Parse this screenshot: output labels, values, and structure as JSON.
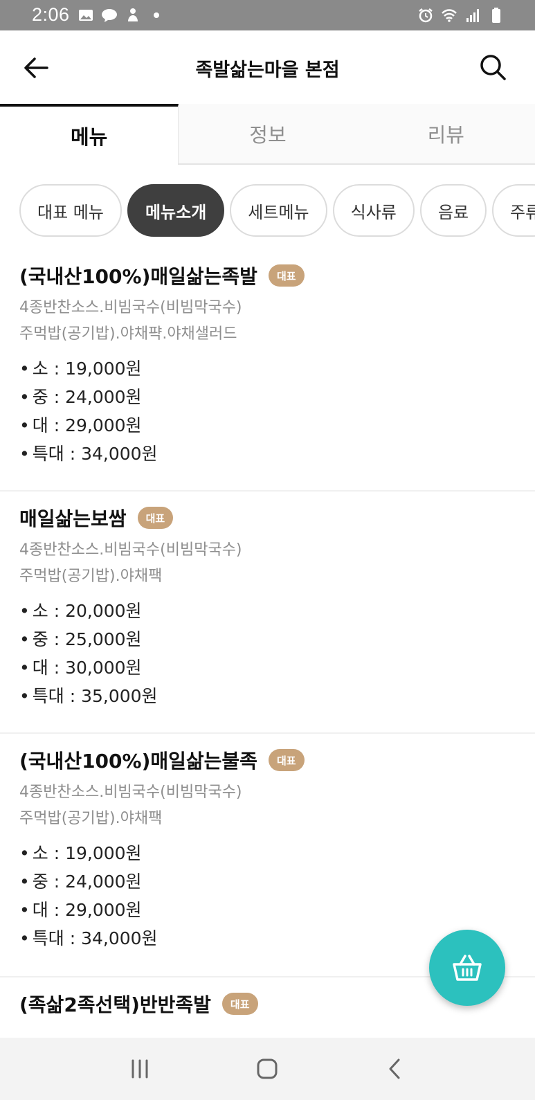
{
  "status_bar": {
    "time": "2:06",
    "left_icons": [
      "gallery-icon",
      "kakaotalk-icon",
      "notification-icon",
      "dot-icon"
    ],
    "right_icons": [
      "alarm-icon",
      "wifi-icon",
      "signal-icon",
      "battery-icon"
    ]
  },
  "header": {
    "title": "족발삶는마을 본점"
  },
  "tabs": [
    {
      "label": "메뉴",
      "active": true
    },
    {
      "label": "정보",
      "active": false
    },
    {
      "label": "리뷰",
      "active": false
    }
  ],
  "chips": [
    {
      "label": "대표 메뉴",
      "active": false
    },
    {
      "label": "메뉴소개",
      "active": true
    },
    {
      "label": "세트메뉴",
      "active": false
    },
    {
      "label": "식사류",
      "active": false
    },
    {
      "label": "음료",
      "active": false
    },
    {
      "label": "주류",
      "active": false
    }
  ],
  "menu_items": [
    {
      "name": "(국내산100%)매일삶는족발",
      "badge": "대표",
      "desc_lines": [
        "4종반찬소스.비빔국수(비빔막국수)",
        "주먹밥(공기밥).야채퍅.야채샐러드"
      ],
      "prices": [
        "소 : 19,000원",
        "중 : 24,000원",
        "대 : 29,000원",
        "특대 : 34,000원"
      ]
    },
    {
      "name": "매일삶는보쌈",
      "badge": "대표",
      "desc_lines": [
        "4종반찬소스.비빔국수(비빔막국수)",
        "주먹밥(공기밥).야채팩"
      ],
      "prices": [
        "소 : 20,000원",
        "중 : 25,000원",
        "대 : 30,000원",
        "특대 : 35,000원"
      ]
    },
    {
      "name": "(국내산100%)매일삶는불족",
      "badge": "대표",
      "desc_lines": [
        "4종반찬소스.비빔국수(비빔막국수)",
        "주먹밥(공기밥).야채팩"
      ],
      "prices": [
        "소 : 19,000원",
        "중 : 24,000원",
        "대 : 29,000원",
        "특대 : 34,000원"
      ]
    },
    {
      "name": "(족삶2족선택)반반족발",
      "badge": "대표",
      "desc_lines": [],
      "prices": []
    }
  ],
  "colors": {
    "badge": "#c8a37a",
    "fab": "#2cc1be",
    "active_chip": "#3f3f3f"
  }
}
